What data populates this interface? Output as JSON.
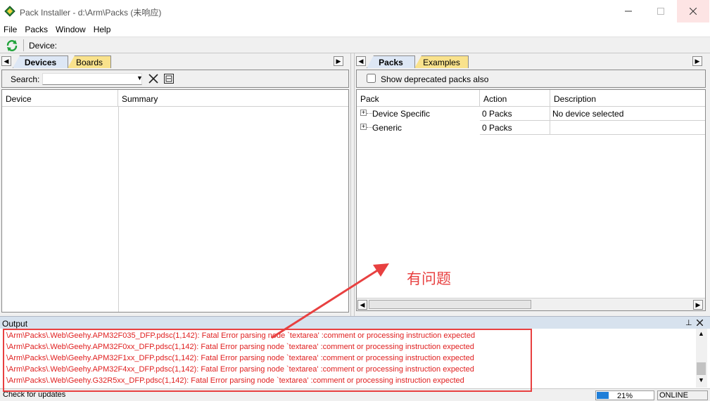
{
  "window": {
    "title": "Pack Installer - d:\\Arm\\Packs (未响应)",
    "min_icon": "minimize-icon",
    "max_icon": "maximize-icon",
    "close_icon": "close-icon"
  },
  "menu": [
    "File",
    "Packs",
    "Window",
    "Help"
  ],
  "toolbar": {
    "device_label": "Device:",
    "refresh_icon": "refresh-icon"
  },
  "left_panel": {
    "tabs": [
      {
        "label": "Devices",
        "active": true
      },
      {
        "label": "Boards",
        "active": false
      }
    ],
    "search_label": "Search:",
    "search_value": "",
    "columns": [
      "Device",
      "Summary"
    ]
  },
  "right_panel": {
    "tabs": [
      {
        "label": "Packs",
        "active": true
      },
      {
        "label": "Examples",
        "active": false
      }
    ],
    "deprecated_checkbox_label": "Show deprecated packs also",
    "deprecated_checked": false,
    "columns": [
      "Pack",
      "Action",
      "Description"
    ],
    "rows": [
      {
        "pack": "Device Specific",
        "action": "0 Packs",
        "description": "No device selected"
      },
      {
        "pack": "Generic",
        "action": "0 Packs",
        "description": ""
      }
    ]
  },
  "output": {
    "title": "Output",
    "lines": [
      "\\Arm\\Packs\\.Web\\Geehy.APM32F035_DFP.pdsc(1,142): Fatal Error parsing node `textarea' :comment or processing instruction expected",
      "\\Arm\\Packs\\.Web\\Geehy.APM32F0xx_DFP.pdsc(1,142): Fatal Error parsing node `textarea' :comment or processing instruction expected",
      "\\Arm\\Packs\\.Web\\Geehy.APM32F1xx_DFP.pdsc(1,142): Fatal Error parsing node `textarea' :comment or processing instruction expected",
      "\\Arm\\Packs\\.Web\\Geehy.APM32F4xx_DFP.pdsc(1,142): Fatal Error parsing node `textarea' :comment or processing instruction expected",
      "\\Arm\\Packs\\.Web\\Geehy.G32R5xx_DFP.pdsc(1,142): Fatal Error parsing node `textarea' :comment or processing instruction expected"
    ]
  },
  "status": {
    "text": "Check for updates",
    "progress_label": "21%",
    "progress_percent": 21,
    "connection": "ONLINE"
  },
  "annotation": {
    "text": "有问题"
  },
  "colors": {
    "error_text": "#e02020",
    "annotation": "#e84040",
    "active_tab": "#dde7f5",
    "inactive_tab": "#f9e28c"
  }
}
